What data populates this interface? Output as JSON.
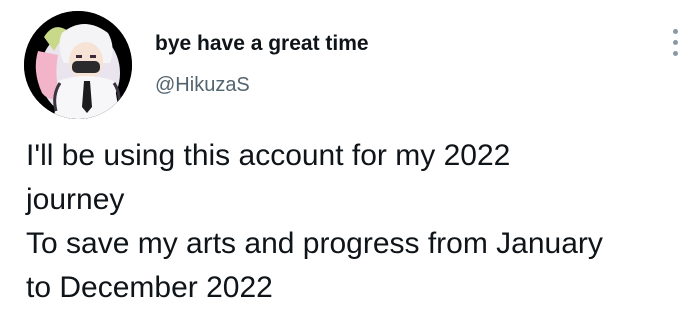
{
  "author": {
    "display_name": "bye have a great time",
    "handle": "@HikuzaS",
    "avatar_icon": "profile-avatar-anime-character"
  },
  "tweet": {
    "lines": [
      "I'll be using this account for my 2022",
      "journey",
      "To save my arts and progress from January",
      "to December 2022"
    ]
  },
  "menu": {
    "icon": "more-options-icon"
  },
  "colors": {
    "text_primary": "#0f1419",
    "text_secondary": "#536471",
    "icon_gray": "#8b98a5",
    "background": "#ffffff"
  }
}
